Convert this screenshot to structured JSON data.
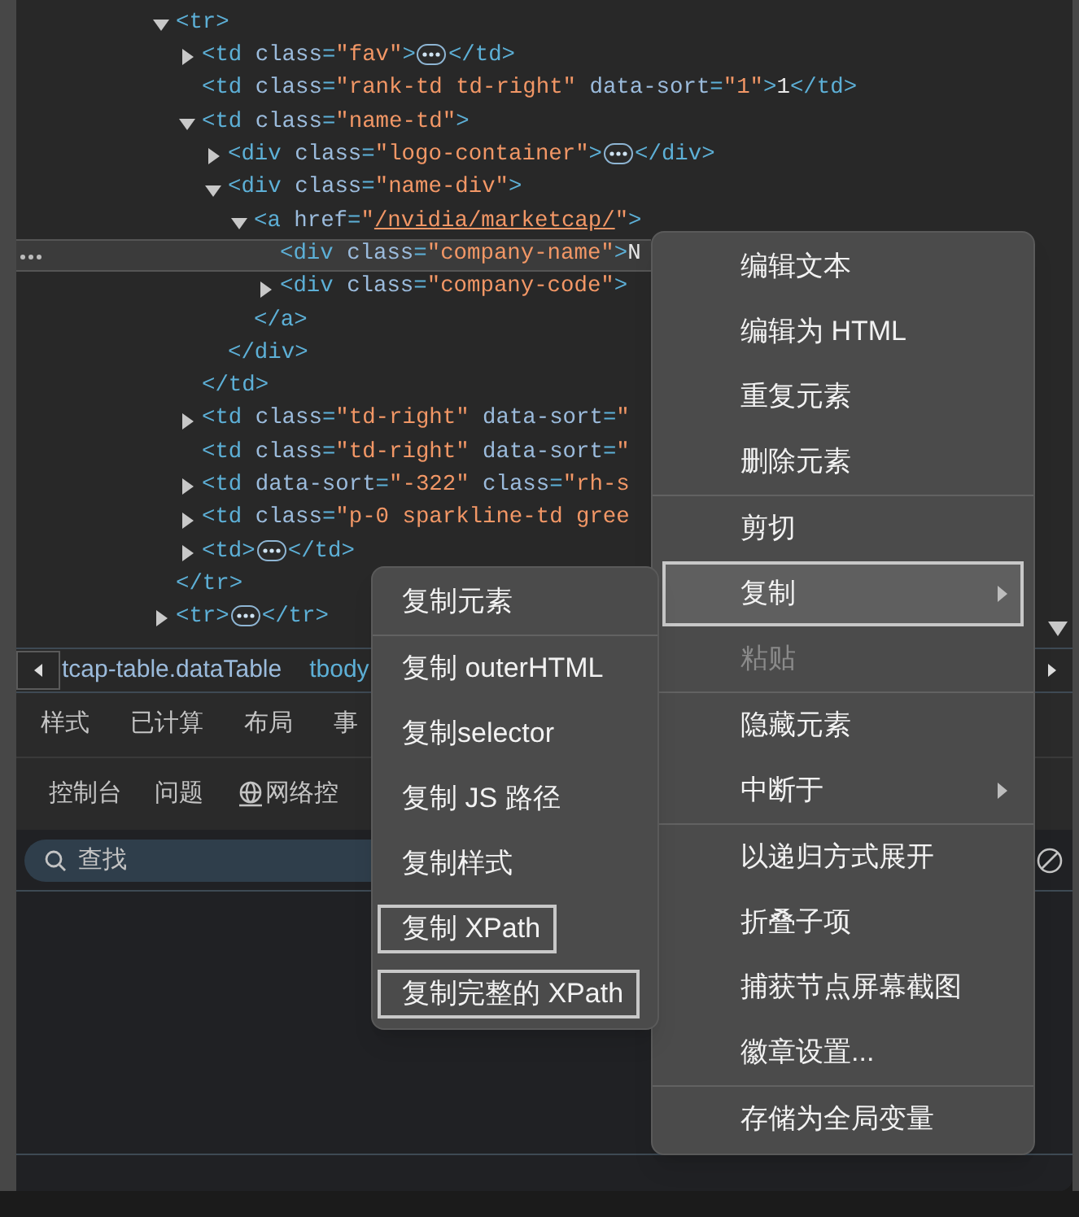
{
  "dom_tree": [
    {
      "expanded": true,
      "selected": false,
      "open": [
        {
          "kind": "tag",
          "text": "<tr>"
        }
      ],
      "close": [
        {
          "kind": "tag",
          "text": "</tr>"
        }
      ],
      "children": [
        {
          "expanded": false,
          "selected": false,
          "open": [
            {
              "kind": "tag",
              "text": "<td "
            },
            {
              "kind": "attr",
              "text": "class"
            },
            {
              "kind": "tag",
              "text": "="
            },
            {
              "kind": "value",
              "text": "\"fav\""
            },
            {
              "kind": "tag",
              "text": ">"
            },
            {
              "kind": "ellipsis"
            },
            {
              "kind": "tag",
              "text": "</td>"
            }
          ]
        },
        {
          "selected": false,
          "open": [
            {
              "kind": "tag",
              "text": "<td "
            },
            {
              "kind": "attr",
              "text": "class"
            },
            {
              "kind": "tag",
              "text": "="
            },
            {
              "kind": "value",
              "text": "\"rank-td td-right\""
            },
            {
              "kind": "attr",
              "text": " data-sort"
            },
            {
              "kind": "tag",
              "text": "="
            },
            {
              "kind": "value",
              "text": "\"1\""
            },
            {
              "kind": "tag",
              "text": ">"
            },
            {
              "kind": "text",
              "text": "1"
            },
            {
              "kind": "tag",
              "text": "</td>"
            }
          ]
        },
        {
          "expanded": true,
          "selected": false,
          "open": [
            {
              "kind": "tag",
              "text": "<td "
            },
            {
              "kind": "attr",
              "text": "class"
            },
            {
              "kind": "tag",
              "text": "="
            },
            {
              "kind": "value",
              "text": "\"name-td\""
            },
            {
              "kind": "tag",
              "text": ">"
            }
          ],
          "close": [
            {
              "kind": "tag",
              "text": "</td>"
            }
          ],
          "children": [
            {
              "expanded": false,
              "selected": false,
              "open": [
                {
                  "kind": "tag",
                  "text": "<div "
                },
                {
                  "kind": "attr",
                  "text": "class"
                },
                {
                  "kind": "tag",
                  "text": "="
                },
                {
                  "kind": "value",
                  "text": "\"logo-container\""
                },
                {
                  "kind": "tag",
                  "text": ">"
                },
                {
                  "kind": "ellipsis"
                },
                {
                  "kind": "tag",
                  "text": "</div>"
                }
              ]
            },
            {
              "expanded": true,
              "selected": false,
              "open": [
                {
                  "kind": "tag",
                  "text": "<div "
                },
                {
                  "kind": "attr",
                  "text": "class"
                },
                {
                  "kind": "tag",
                  "text": "="
                },
                {
                  "kind": "value",
                  "text": "\"name-div\""
                },
                {
                  "kind": "tag",
                  "text": ">"
                }
              ],
              "close": [
                {
                  "kind": "tag",
                  "text": "</div>"
                }
              ],
              "children": [
                {
                  "expanded": true,
                  "selected": false,
                  "open": [
                    {
                      "kind": "tag",
                      "text": "<a "
                    },
                    {
                      "kind": "attr",
                      "text": "href"
                    },
                    {
                      "kind": "tag",
                      "text": "="
                    },
                    {
                      "kind": "value",
                      "text": "\""
                    },
                    {
                      "kind": "link",
                      "text": "/nvidia/marketcap/"
                    },
                    {
                      "kind": "value",
                      "text": "\""
                    },
                    {
                      "kind": "tag",
                      "text": ">"
                    }
                  ],
                  "close": [
                    {
                      "kind": "tag",
                      "text": "</a>"
                    }
                  ],
                  "children": [
                    {
                      "selected": true,
                      "open": [
                        {
                          "kind": "tag",
                          "text": "<div "
                        },
                        {
                          "kind": "attr",
                          "text": "class"
                        },
                        {
                          "kind": "tag",
                          "text": "="
                        },
                        {
                          "kind": "value",
                          "text": "\"company-name\""
                        },
                        {
                          "kind": "tag",
                          "text": ">"
                        },
                        {
                          "kind": "text",
                          "text": "N"
                        }
                      ]
                    },
                    {
                      "expanded": false,
                      "selected": false,
                      "open": [
                        {
                          "kind": "tag",
                          "text": "<div "
                        },
                        {
                          "kind": "attr",
                          "text": "class"
                        },
                        {
                          "kind": "tag",
                          "text": "="
                        },
                        {
                          "kind": "value",
                          "text": "\"company-code\""
                        },
                        {
                          "kind": "tag",
                          "text": ">"
                        }
                      ]
                    }
                  ]
                }
              ]
            }
          ]
        },
        {
          "expanded": false,
          "selected": false,
          "open": [
            {
              "kind": "tag",
              "text": "<td "
            },
            {
              "kind": "attr",
              "text": "class"
            },
            {
              "kind": "tag",
              "text": "="
            },
            {
              "kind": "value",
              "text": "\"td-right\""
            },
            {
              "kind": "attr",
              "text": " data-sort"
            },
            {
              "kind": "tag",
              "text": "="
            },
            {
              "kind": "value",
              "text": "\""
            }
          ]
        },
        {
          "selected": false,
          "open": [
            {
              "kind": "tag",
              "text": "<td "
            },
            {
              "kind": "attr",
              "text": "class"
            },
            {
              "kind": "tag",
              "text": "="
            },
            {
              "kind": "value",
              "text": "\"td-right\""
            },
            {
              "kind": "attr",
              "text": " data-sort"
            },
            {
              "kind": "tag",
              "text": "="
            },
            {
              "kind": "value",
              "text": "\""
            }
          ]
        },
        {
          "expanded": false,
          "selected": false,
          "open": [
            {
              "kind": "tag",
              "text": "<td "
            },
            {
              "kind": "attr",
              "text": "data-sort"
            },
            {
              "kind": "tag",
              "text": "="
            },
            {
              "kind": "value",
              "text": "\"-322\""
            },
            {
              "kind": "attr",
              "text": " class"
            },
            {
              "kind": "tag",
              "text": "="
            },
            {
              "kind": "value",
              "text": "\"rh-s"
            }
          ]
        },
        {
          "expanded": false,
          "selected": false,
          "open": [
            {
              "kind": "tag",
              "text": "<td "
            },
            {
              "kind": "attr",
              "text": "class"
            },
            {
              "kind": "tag",
              "text": "="
            },
            {
              "kind": "value",
              "text": "\"p-0 sparkline-td gree"
            }
          ]
        },
        {
          "expanded": false,
          "selected": false,
          "open": [
            {
              "kind": "tag",
              "text": "<td>"
            },
            {
              "kind": "ellipsis"
            },
            {
              "kind": "tag",
              "text": "</td>"
            }
          ]
        }
      ]
    },
    {
      "expanded": false,
      "selected": false,
      "open": [
        {
          "kind": "tag",
          "text": "<tr>"
        },
        {
          "kind": "ellipsis"
        },
        {
          "kind": "tag",
          "text": "</tr>"
        }
      ]
    }
  ],
  "breadcrumb": [
    {
      "text": "tcap-table.dataTable",
      "kind": "plain"
    },
    {
      "text": "tbody",
      "kind": "tag"
    }
  ],
  "panel_tabs": [
    {
      "label": "样式",
      "selected": false
    },
    {
      "label": "已计算",
      "selected": false
    },
    {
      "label": "布局",
      "selected": false
    },
    {
      "label": "事",
      "selected": false
    }
  ],
  "drawer_tabs": [
    {
      "label": "控制台",
      "selected": false,
      "kind": "plain"
    },
    {
      "label": "问题",
      "selected": false,
      "kind": "plain"
    },
    {
      "label": "网络控",
      "selected": false,
      "kind": "network"
    }
  ],
  "search": {
    "placeholder": "查找"
  },
  "context_menu": {
    "groups": [
      [
        {
          "label": "编辑文本",
          "selected": false,
          "disabled": false,
          "submenu": false
        },
        {
          "label": "编辑为 HTML",
          "selected": false,
          "disabled": false,
          "submenu": false
        },
        {
          "label": "重复元素",
          "selected": false,
          "disabled": false,
          "submenu": false
        },
        {
          "label": "删除元素",
          "selected": false,
          "disabled": false,
          "submenu": false
        }
      ],
      [
        {
          "label": "剪切",
          "selected": false,
          "disabled": false,
          "submenu": false
        },
        {
          "label": "复制",
          "selected": true,
          "disabled": false,
          "submenu": true
        },
        {
          "label": "粘贴",
          "selected": false,
          "disabled": true,
          "submenu": false
        }
      ],
      [
        {
          "label": "隐藏元素",
          "selected": false,
          "disabled": false,
          "submenu": false
        },
        {
          "label": "中断于",
          "selected": false,
          "disabled": false,
          "submenu": true
        }
      ],
      [
        {
          "label": "以递归方式展开",
          "selected": false,
          "disabled": false,
          "submenu": false
        },
        {
          "label": "折叠子项",
          "selected": false,
          "disabled": false,
          "submenu": false
        },
        {
          "label": "捕获节点屏幕截图",
          "selected": false,
          "disabled": false,
          "submenu": false
        },
        {
          "label": "徽章设置...",
          "selected": false,
          "disabled": false,
          "submenu": false
        }
      ],
      [
        {
          "label": "存储为全局变量",
          "selected": false,
          "disabled": false,
          "submenu": false
        }
      ]
    ]
  },
  "copy_submenu": {
    "groups": [
      [
        {
          "label": "复制元素",
          "outlined": false
        }
      ],
      [
        {
          "label": "复制 outerHTML",
          "outlined": false
        },
        {
          "label": "复制selector",
          "outlined": false
        },
        {
          "label": "复制 JS 路径",
          "outlined": false
        },
        {
          "label": "复制样式",
          "outlined": false
        },
        {
          "label": "复制 XPath",
          "outlined": true
        },
        {
          "label": "复制完整的 XPath",
          "outlined": true
        }
      ]
    ]
  }
}
